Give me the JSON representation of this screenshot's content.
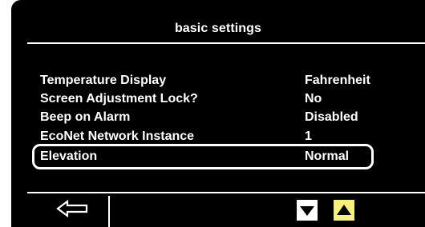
{
  "header": {
    "title": "basic settings"
  },
  "settings": [
    {
      "label": "Temperature Display",
      "value": "Fahrenheit"
    },
    {
      "label": "Screen Adjustment Lock?",
      "value": "No"
    },
    {
      "label": "Beep on Alarm",
      "value": "Disabled"
    },
    {
      "label": "EcoNet Network Instance",
      "value": "1"
    },
    {
      "label": "Elevation",
      "value": "Normal"
    }
  ],
  "selected_item": "Elevation",
  "footer": {
    "back_icon": "left-arrow-icon",
    "down_icon": "triangle-down-icon",
    "up_icon": "triangle-up-icon"
  },
  "colors": {
    "screen_background": "#000000",
    "text": "#ffffff",
    "up_button": "#f7f17a"
  }
}
